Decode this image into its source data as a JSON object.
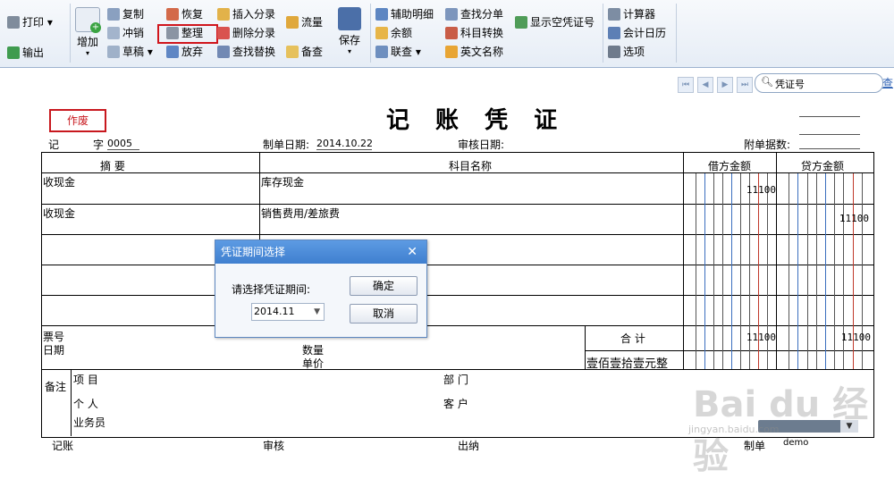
{
  "toolbar": {
    "print": "打印",
    "export": "输出",
    "add": "增加",
    "copy": "复制",
    "reverse": "冲销",
    "draft": "草稿",
    "restore": "恢复",
    "organize": "整理",
    "discard": "放弃",
    "insert_entry": "插入分录",
    "delete_entry": "删除分录",
    "find_replace": "查找替换",
    "flow": "流量",
    "memo": "备查",
    "save": "保存",
    "aux_detail": "辅助明细",
    "balance": "余额",
    "link_query": "联查",
    "find_entry": "查找分单",
    "account_convert": "科目转换",
    "english_name": "英文名称",
    "show_empty": "显示空凭证号",
    "calculator": "计算器",
    "calendar": "会计日历",
    "options": "选项"
  },
  "search": {
    "placeholder": "凭证号",
    "query_link": "查"
  },
  "voucher": {
    "void_stamp": "作废",
    "title": "记 账 凭 证",
    "type_label": "记",
    "no_label": "字",
    "no_value": "0005",
    "date_label": "制单日期:",
    "date_value": "2014.10.22",
    "audit_date_label": "审核日期:",
    "attach_label": "附单据数:",
    "headers": {
      "summary": "摘 要",
      "account": "科目名称",
      "debit": "借方金额",
      "credit": "贷方金额"
    },
    "rows": [
      {
        "summary": "收现金",
        "account": "库存现金",
        "debit": "11100",
        "credit": ""
      },
      {
        "summary": "收现金",
        "account": "销售费用/差旅费",
        "debit": "",
        "credit": "11100"
      }
    ],
    "bill_no_label": "票号",
    "bill_date_label": "日期",
    "qty_label": "数量",
    "price_label": "单价",
    "total_label": "合 计",
    "total_debit": "11100",
    "total_credit": "11100",
    "total_words": "壹佰壹拾壹元整",
    "memo_label": "备注",
    "project_label": "项 目",
    "dept_label": "部 门",
    "person_label": "个 人",
    "customer_label": "客 户",
    "salesman_label": "业务员",
    "bookkeeper_label": "记账",
    "auditor_label": "审核",
    "cashier_label": "出纳",
    "maker_label": "制单",
    "maker_value": "demo"
  },
  "dialog": {
    "title": "凭证期间选择",
    "prompt": "请选择凭证期间:",
    "period_value": "2014.11",
    "ok": "确定",
    "cancel": "取消"
  },
  "watermark": {
    "text": "Bai du 经验",
    "url": "jingyan.baidu.com"
  }
}
